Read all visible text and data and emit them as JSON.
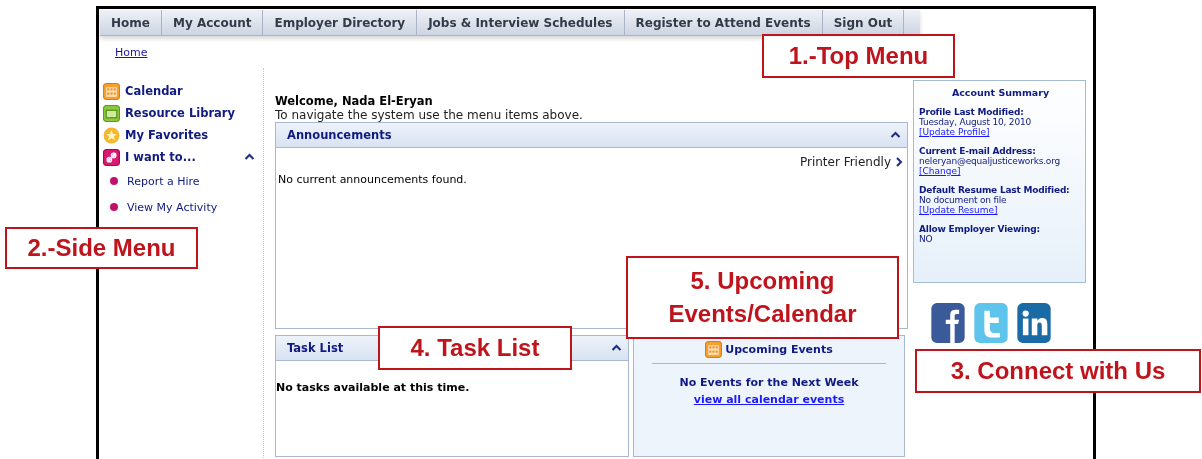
{
  "top_menu": [
    {
      "label": "Home"
    },
    {
      "label": "My Account"
    },
    {
      "label": "Employer Directory"
    },
    {
      "label": "Jobs & Interview Schedules"
    },
    {
      "label": "Register to Attend Events"
    },
    {
      "label": "Sign Out"
    }
  ],
  "breadcrumb": "Home",
  "side_menu": {
    "items": [
      {
        "label": "Calendar",
        "kind": "calendar"
      },
      {
        "label": "Resource Library",
        "kind": "folder"
      },
      {
        "label": "My Favorites",
        "kind": "star"
      },
      {
        "label": "I want to...",
        "kind": "link",
        "expanded": true,
        "children": [
          {
            "label": "Report a Hire"
          },
          {
            "label": "View My Activity"
          }
        ]
      }
    ]
  },
  "welcome": {
    "title": "Welcome, Nada El-Eryan",
    "text": "To navigate the system use the menu items above."
  },
  "announcements": {
    "title": "Announcements",
    "expanded": true,
    "printer_link": "Printer Friendly",
    "message": "No current announcements found."
  },
  "task_list": {
    "title": "Task List",
    "expanded": true,
    "message": "No tasks available at this time."
  },
  "upcoming_events": {
    "title": "Upcoming Events",
    "message": "No Events for the Next Week",
    "link": "view all calendar events"
  },
  "account_summary": {
    "title": "Account Summary",
    "sections": [
      {
        "label": "Profile Last Modified:",
        "value": "Tuesday, August 10, 2010",
        "link": "[Update Profile]"
      },
      {
        "label": "Current E-mail Address:",
        "value": "neleryan@equaljusticeworks.org",
        "link": "[Change]"
      },
      {
        "label": "Default Resume Last Modified:",
        "value": "No document on file",
        "link": "[Update Resume]"
      },
      {
        "label": "Allow Employer Viewing:",
        "value": "NO"
      }
    ]
  },
  "social_links": [
    {
      "kind": "facebook"
    },
    {
      "kind": "twitter"
    },
    {
      "kind": "linkedin"
    }
  ],
  "annotations": [
    "1.-Top Menu",
    "2.-Side Menu",
    "3. Connect with Us",
    "4. Task List",
    "5. Upcoming Events/Calendar"
  ]
}
